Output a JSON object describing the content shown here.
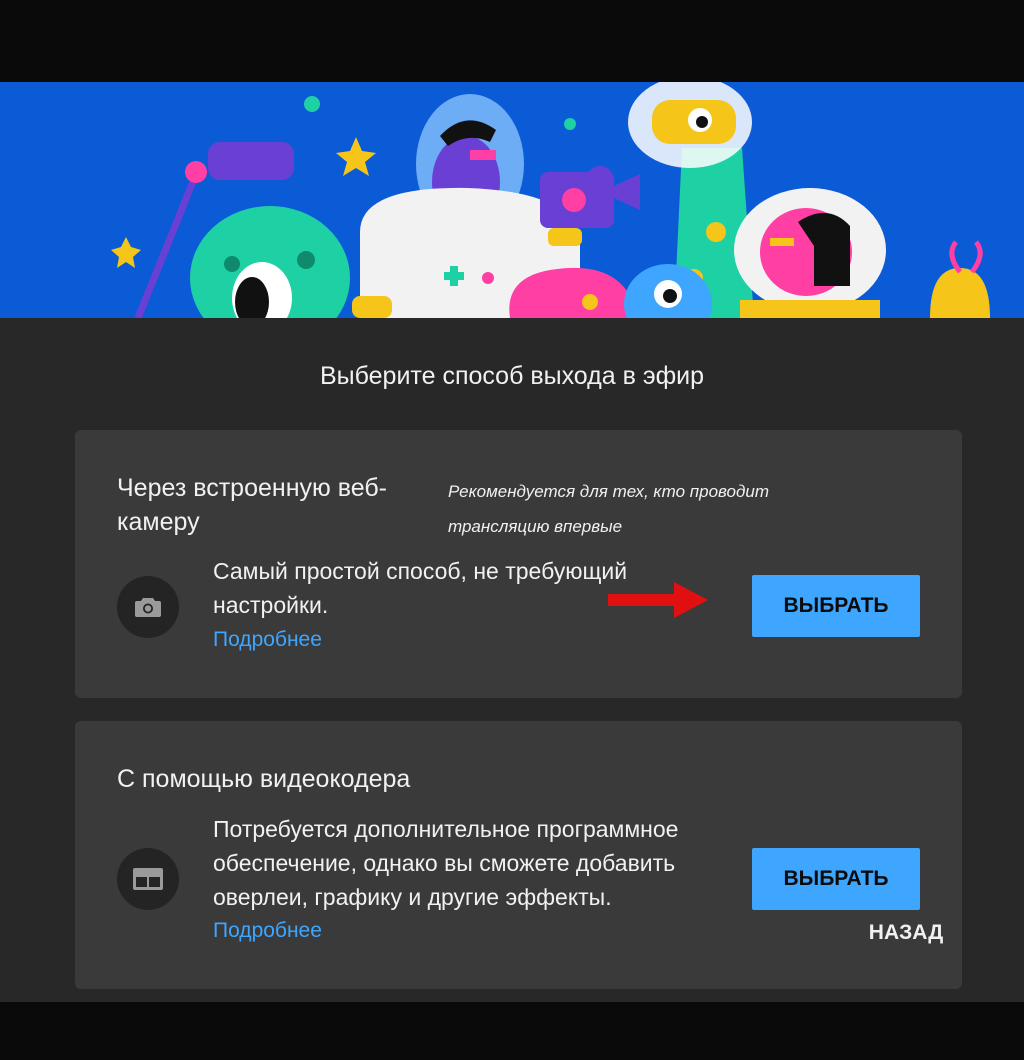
{
  "dialog": {
    "title": "Выберите способ выхода в эфир",
    "back_label": "НАЗАД"
  },
  "options": [
    {
      "title": "Через встроенную веб-камеру",
      "recommendation": "Рекомендуется для тех, кто проводит трансляцию впервые",
      "description": "Самый простой способ, не требующий настройки.",
      "more_link": "Подробнее",
      "button_label": "ВЫБРАТЬ",
      "icon": "camera-icon"
    },
    {
      "title": "С помощью видеокодера",
      "description": "Потребуется дополнительное программное обеспечение, однако вы сможете добавить оверлеи, графику и другие эффекты.",
      "more_link": "Подробнее",
      "button_label": "ВЫБРАТЬ",
      "icon": "encoder-icon"
    }
  ],
  "colors": {
    "banner_bg": "#0b5bd6",
    "dialog_bg": "#282828",
    "card_bg": "#3a3a3a",
    "accent": "#3ea6ff",
    "annotation_arrow": "#e01010"
  }
}
